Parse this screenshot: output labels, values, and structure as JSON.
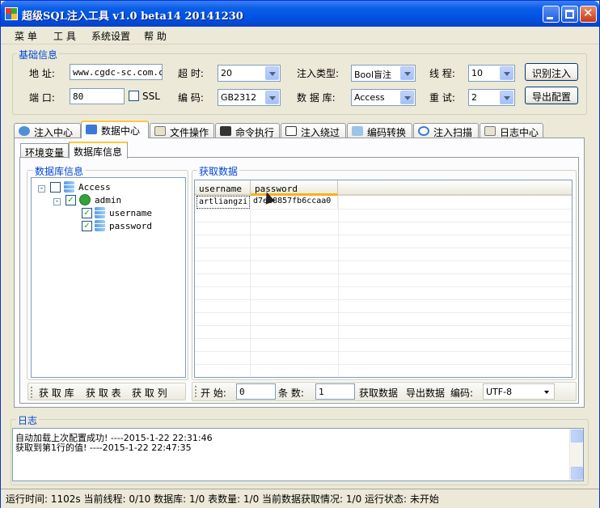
{
  "window": {
    "title": "超级SQL注入工具 v1.0 beta14 20141230"
  },
  "menu": [
    "菜 单",
    "工 具",
    "系统设置",
    "帮 助"
  ],
  "basic": {
    "group_label": "基础信息",
    "address_label": "地 址:",
    "address_value": "www.cgdc-sc.com.cn",
    "port_label": "端 口:",
    "port_value": "80",
    "ssl_label": "SSL",
    "timeout_label": "超 时:",
    "timeout_value": "20",
    "encoding_label": "编 码:",
    "encoding_value": "GB2312",
    "inject_type_label": "注入类型:",
    "inject_type_value": "Bool盲注",
    "db_label": "数 据 库:",
    "db_value": "Access",
    "threads_label": "线 程:",
    "threads_value": "10",
    "retry_label": "重 试:",
    "retry_value": "2",
    "identify_button": "识别注入",
    "export_button": "导出配置"
  },
  "tabs": [
    "注入中心",
    "数据中心",
    "文件操作",
    "命令执行",
    "注入绕过",
    "编码转换",
    "注入扫描",
    "日志中心"
  ],
  "subtabs": [
    "环境变量",
    "数据库信息"
  ],
  "tree": {
    "group_label": "数据库信息",
    "root": "Access",
    "table": "admin",
    "columns": [
      "username",
      "password"
    ]
  },
  "data": {
    "group_label": "获取数据",
    "headers": [
      "username",
      "password"
    ],
    "rows": [
      [
        "artliangzi",
        "d7ec8857fb6ccaa0"
      ]
    ]
  },
  "left_toolbar": [
    "获 取 库",
    "获 取 表",
    "获 取 列"
  ],
  "right_toolbar": {
    "start_label": "开 始:",
    "start_value": "0",
    "count_label": "条 数:",
    "count_value": "1",
    "fetch_label": "获取数据",
    "export_label": "导出数据",
    "encoding_label": "编码:",
    "encoding_value": "UTF-8"
  },
  "log": {
    "group_label": "日志",
    "lines": [
      "自动加载上次配置成功! ----2015-1-22 22:31:46",
      "获取到第1行的值! ----2015-1-22 22:47:35"
    ]
  },
  "status": "运行时间: 1102s 当前线程: 0/10 数据库: 1/0 表数量: 1/0 当前数据获取情况: 1/0 运行状态: 未开始"
}
